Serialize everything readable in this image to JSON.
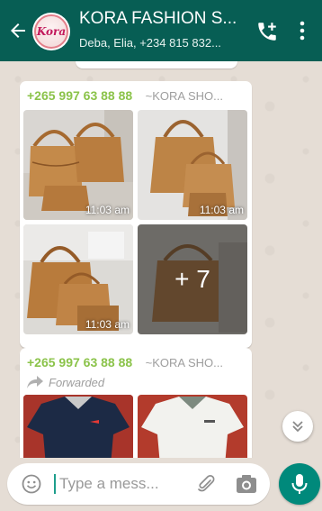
{
  "header": {
    "title": "KORA FASHION S...",
    "subtitle": "Deba, Elia, +234 815 832...",
    "avatar_text": "Kora",
    "icons": {
      "back": "back-arrow-icon",
      "call": "add-call-icon",
      "menu": "more-options-icon"
    }
  },
  "messages": [
    {
      "sender_phone": "+265 997 63 88 88",
      "sender_name": "~KORA SHO...",
      "photos": [
        {
          "time": "11:03 am"
        },
        {
          "time": "11:03 am"
        },
        {
          "time": "11:03 am"
        },
        {
          "more_label": "+ 7"
        }
      ]
    },
    {
      "sender_phone": "+265 997 63 88 88",
      "sender_name": "~KORA SHO...",
      "forwarded_label": "Forwarded"
    }
  ],
  "composer": {
    "placeholder": "Type a mess...",
    "icons": {
      "emoji": "emoji-icon",
      "attach": "paperclip-icon",
      "camera": "camera-icon",
      "mic": "microphone-icon"
    }
  },
  "colors": {
    "header_bg": "#075e54",
    "sender_phone": "#8bc34a",
    "mic_button": "#00897b",
    "chat_bg": "#e5ddd5"
  }
}
